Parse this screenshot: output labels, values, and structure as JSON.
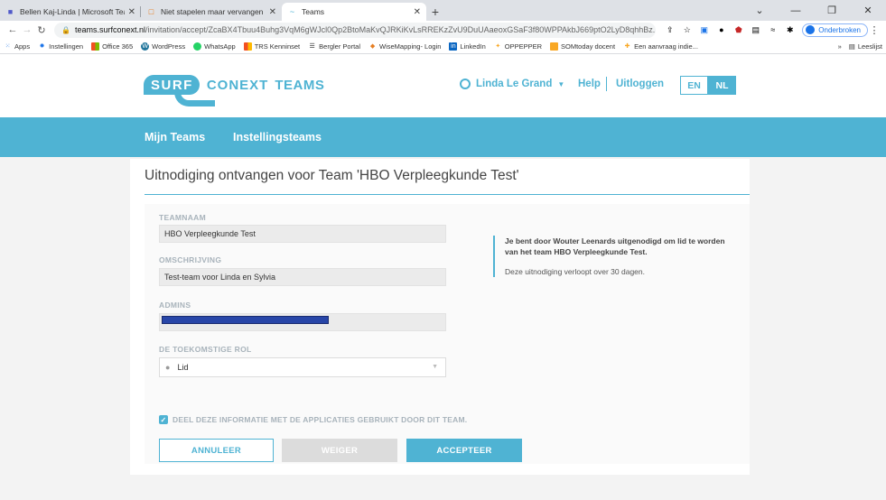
{
  "browser": {
    "tabs": [
      {
        "icon": "teams-icon",
        "title": "Bellen Kaj-Linda | Microsoft Teams"
      },
      {
        "icon": "document-icon",
        "title": "Niet stapelen maar vervangen sl..."
      },
      {
        "icon": "surf-icon",
        "title": "Teams"
      }
    ],
    "url_host": "teams.surfconext.nl",
    "url_path": "/invitation/accept/ZcaBX4Tbuu4Buhg3VqM6gWJcl0Qp2BtoMaKvQJRKiKvLsRREKzZvU9DuUAaeoxGSaF3f80WPPAkbJ669ptO2LyD8qhhBz...",
    "profile_label": "Onderbroken",
    "bookmarks": [
      {
        "icon": "apps-icon",
        "label": "Apps"
      },
      {
        "icon": "gear-icon",
        "label": "Instellingen"
      },
      {
        "icon": "office-icon",
        "label": "Office 365"
      },
      {
        "icon": "wordpress-icon",
        "label": "WordPress"
      },
      {
        "icon": "whatsapp-icon",
        "label": "WhatsApp"
      },
      {
        "icon": "trs-icon",
        "label": "TRS Kenninset"
      },
      {
        "icon": "bergler-icon",
        "label": "Bergler Portal"
      },
      {
        "icon": "wisemapping-icon",
        "label": "WiseMapping- Login"
      },
      {
        "icon": "linkedin-icon",
        "label": "LinkedIn"
      },
      {
        "icon": "oppepper-icon",
        "label": "OPPEPPER"
      },
      {
        "icon": "somtoday-icon",
        "label": "SOMtoday docent"
      },
      {
        "icon": "aanvraag-icon",
        "label": "Een aanvraag indie..."
      }
    ],
    "readinglist_label": "Leeslijst"
  },
  "header": {
    "logo_surf": "SURF",
    "logo_conext": "CONEXT",
    "logo_teams": "TEAMS",
    "user_name": "Linda Le Grand",
    "help": "Help",
    "logout": "Uitloggen",
    "lang_en": "EN",
    "lang_nl": "NL",
    "active_lang": "NL"
  },
  "nav": {
    "my_teams": "Mijn Teams",
    "institution_teams": "Instellingsteams"
  },
  "invitation": {
    "title": "Uitnodiging ontvangen voor Team 'HBO Verpleegkunde Test'",
    "team_name_label": "TEAMNAAM",
    "team_name": "HBO Verpleegkunde Test",
    "description_label": "OMSCHRIJVING",
    "description": "Test-team voor Linda en Sylvia",
    "admins_label": "ADMINS",
    "future_role_label": "DE TOEKOMSTIGE ROL",
    "future_role": "Lid",
    "share_info_label": "DEEL DEZE INFORMATIE MET DE APPLICATIES GEBRUIKT DOOR DIT TEAM.",
    "share_info_checked": true,
    "cancel_button": "ANNULEER",
    "decline_button": "WEIGER",
    "accept_button": "ACCEPTEER",
    "info_message": "Je bent door Wouter Leenards uitgenodigd om lid te worden van het team HBO Verpleegkunde Test.",
    "expiry_message": "Deze uitnodiging verloopt over 30 dagen."
  },
  "colors": {
    "brand": "#4fb3d3",
    "redaction": "#2846a8"
  }
}
